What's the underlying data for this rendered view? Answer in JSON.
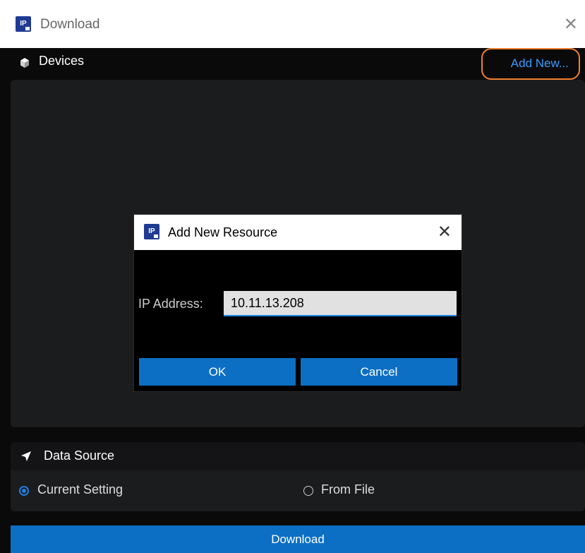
{
  "window": {
    "title": "Download",
    "close_glyph": "✕",
    "logo_icon": "app-logo-icon"
  },
  "devices": {
    "label": "Devices",
    "icon": "cube-icon",
    "add_new_label": "Add New..."
  },
  "data_source": {
    "label": "Data Source",
    "icon": "navigation-arrow-icon",
    "options": [
      {
        "label": "Current Setting",
        "selected": true
      },
      {
        "label": "From File",
        "selected": false
      }
    ]
  },
  "download_label": "Download",
  "dialog": {
    "title": "Add New Resource",
    "close_glyph": "✕",
    "ip_label": "IP Address:",
    "ip_value": "10.11.13.208",
    "ok_label": "OK",
    "cancel_label": "Cancel"
  },
  "colors": {
    "accent_blue": "#0c6fc4",
    "link_blue": "#3a9bff",
    "highlight_orange": "#f08030",
    "background": "#0a0a0a",
    "panel": "#1b1c1e"
  }
}
